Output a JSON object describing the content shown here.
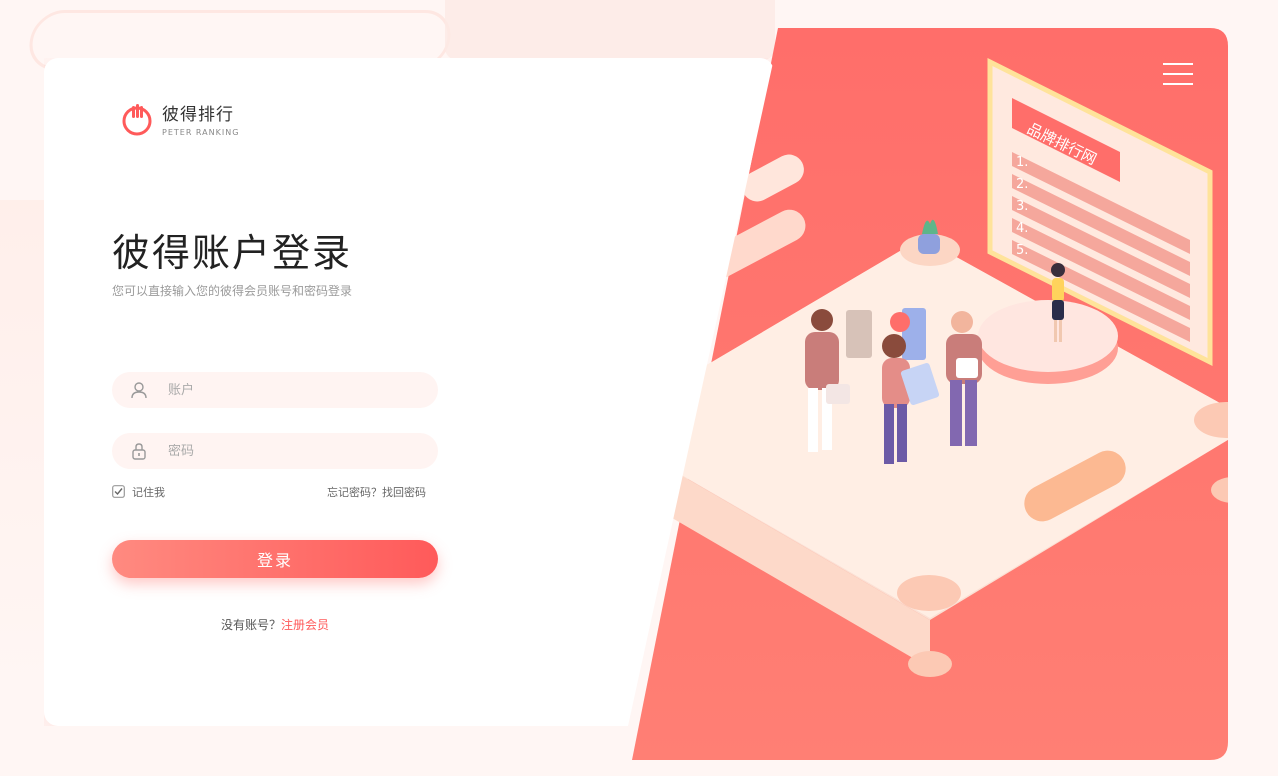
{
  "brand": {
    "name_cn": "彼得排行",
    "name_en": "PETER RANKING",
    "accent": "#ff5a5a"
  },
  "login": {
    "title": "彼得账户登录",
    "subtitle": "您可以直接输入您的彼得会员账号和密码登录",
    "account_placeholder": "账户",
    "password_placeholder": "密码",
    "remember_label": "记住我",
    "forgot_label": "忘记密码？找回密码",
    "submit_label": "登录",
    "no_account_label": "没有账号？",
    "register_label": "注册会员"
  },
  "illustration": {
    "board_title": "品牌排行网",
    "board_items": [
      "1.",
      "2.",
      "3.",
      "4.",
      "5."
    ]
  },
  "icons": {
    "menu": "hamburger-menu-icon",
    "user": "user-icon",
    "lock": "lock-icon",
    "check": "checkbox-icon"
  }
}
